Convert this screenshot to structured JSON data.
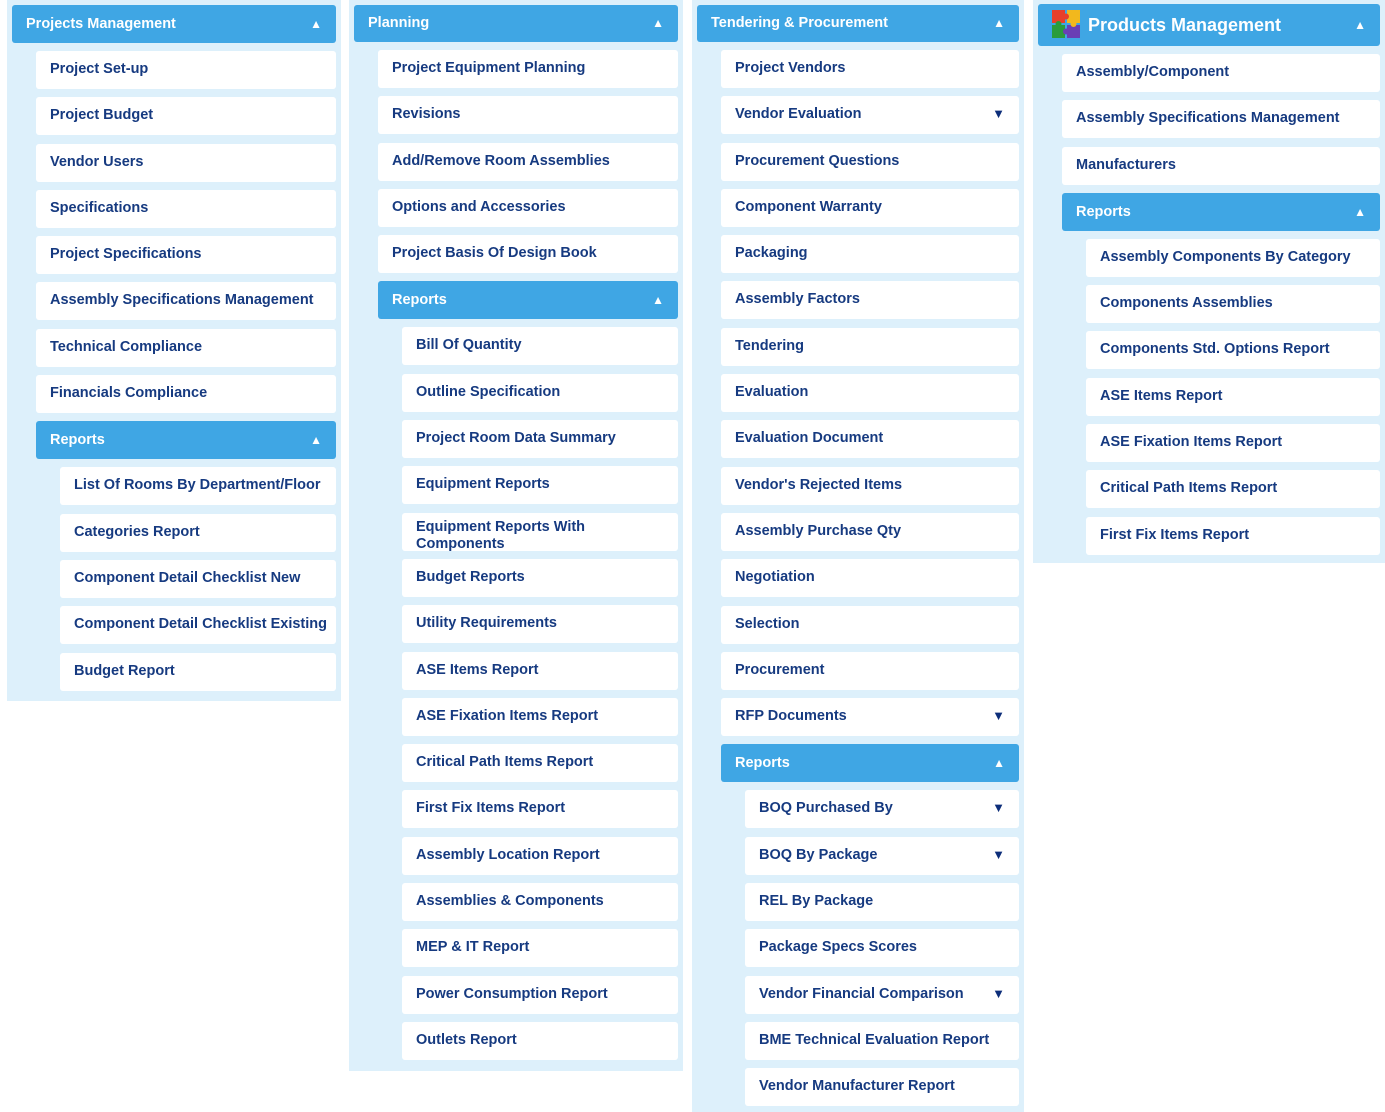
{
  "panels": [
    {
      "title": "Projects Management",
      "items": [
        {
          "label": "Project Set-up",
          "level": 1
        },
        {
          "label": "Project Budget",
          "level": 1
        },
        {
          "label": "Vendor Users",
          "level": 1
        },
        {
          "label": "Specifications",
          "level": 1
        },
        {
          "label": "Project Specifications",
          "level": 1
        },
        {
          "label": "Assembly Specifications Management",
          "level": 1
        },
        {
          "label": "Technical Compliance",
          "level": 1
        },
        {
          "label": "Financials Compliance",
          "level": 1
        },
        {
          "label": "Reports",
          "level": 1,
          "header": true,
          "arrow": "▲"
        },
        {
          "label": "List Of Rooms By Department/Floor",
          "level": 2
        },
        {
          "label": "Categories Report",
          "level": 2
        },
        {
          "label": "Component Detail Checklist New",
          "level": 2
        },
        {
          "label": "Component Detail Checklist Existing",
          "level": 2
        },
        {
          "label": "Budget Report",
          "level": 2
        }
      ]
    },
    {
      "title": "Planning",
      "items": [
        {
          "label": "Project Equipment Planning",
          "level": 1
        },
        {
          "label": "Revisions",
          "level": 1
        },
        {
          "label": "Add/Remove Room Assemblies",
          "level": 1
        },
        {
          "label": "Options and Accessories",
          "level": 1
        },
        {
          "label": "Project Basis Of Design Book",
          "level": 1
        },
        {
          "label": "Reports",
          "level": 1,
          "header": true,
          "arrow": "▲"
        },
        {
          "label": "Bill Of Quantity",
          "level": 2
        },
        {
          "label": "Outline Specification",
          "level": 2
        },
        {
          "label": "Project Room Data Summary",
          "level": 2
        },
        {
          "label": "Equipment Reports",
          "level": 2
        },
        {
          "label": "Equipment Reports With Components",
          "level": 2,
          "wrap": true
        },
        {
          "label": "Budget Reports",
          "level": 2
        },
        {
          "label": "Utility Requirements",
          "level": 2
        },
        {
          "label": "ASE Items Report",
          "level": 2
        },
        {
          "label": "ASE Fixation Items Report",
          "level": 2
        },
        {
          "label": "Critical Path Items Report",
          "level": 2
        },
        {
          "label": "First Fix Items Report",
          "level": 2
        },
        {
          "label": "Assembly Location Report",
          "level": 2
        },
        {
          "label": "Assemblies & Components",
          "level": 2
        },
        {
          "label": "MEP & IT Report",
          "level": 2
        },
        {
          "label": "Power Consumption Report",
          "level": 2
        },
        {
          "label": "Outlets Report",
          "level": 2
        }
      ]
    },
    {
      "title": "Tendering & Procurement",
      "items": [
        {
          "label": "Project Vendors",
          "level": 1
        },
        {
          "label": "Vendor Evaluation",
          "level": 1,
          "arrow": "▼"
        },
        {
          "label": "Procurement Questions",
          "level": 1
        },
        {
          "label": "Component Warranty",
          "level": 1
        },
        {
          "label": "Packaging",
          "level": 1
        },
        {
          "label": "Assembly Factors",
          "level": 1
        },
        {
          "label": "Tendering",
          "level": 1
        },
        {
          "label": "Evaluation",
          "level": 1
        },
        {
          "label": "Evaluation Document",
          "level": 1
        },
        {
          "label": "Vendor's Rejected Items",
          "level": 1
        },
        {
          "label": "Assembly Purchase Qty",
          "level": 1
        },
        {
          "label": "Negotiation",
          "level": 1
        },
        {
          "label": "Selection",
          "level": 1
        },
        {
          "label": "Procurement",
          "level": 1
        },
        {
          "label": "RFP Documents",
          "level": 1,
          "arrow": "▼"
        },
        {
          "label": "Reports",
          "level": 1,
          "header": true,
          "arrow": "▲"
        },
        {
          "label": "BOQ Purchased By",
          "level": 2,
          "arrow": "▼"
        },
        {
          "label": "BOQ By Package",
          "level": 2,
          "arrow": "▼"
        },
        {
          "label": "REL By Package",
          "level": 2
        },
        {
          "label": "Package Specs Scores",
          "level": 2
        },
        {
          "label": "Vendor Financial Comparison",
          "level": 2,
          "arrow": "▼"
        },
        {
          "label": "BME Technical Evaluation Report",
          "level": 2
        },
        {
          "label": "Vendor Manufacturer Report",
          "level": 2
        }
      ]
    },
    {
      "title": "Products Management",
      "items": [
        {
          "label": "Assembly/Component",
          "level": 1
        },
        {
          "label": "Assembly Specifications Management",
          "level": 1
        },
        {
          "label": "Manufacturers",
          "level": 1
        },
        {
          "label": "Reports",
          "level": 1,
          "header": true,
          "arrow": "▲"
        },
        {
          "label": "Assembly Components By Category",
          "level": 2
        },
        {
          "label": "Components Assemblies",
          "level": 2
        },
        {
          "label": "Components Std. Options Report",
          "level": 2
        },
        {
          "label": "ASE Items Report",
          "level": 2
        },
        {
          "label": "ASE Fixation Items Report",
          "level": 2
        },
        {
          "label": "Critical Path Items Report",
          "level": 2
        },
        {
          "label": "First Fix Items Report",
          "level": 2
        }
      ]
    }
  ],
  "header_arrow": "▲",
  "colors": {
    "panel_bg": "#ddf0fb",
    "header_bg": "#3fa6e4",
    "item_text": "#163a80",
    "item_bg": "#ffffff"
  },
  "icons": {
    "products_logo": "puzzle-icon",
    "collapse": "triangle-up-icon",
    "expand": "triangle-down-icon"
  }
}
